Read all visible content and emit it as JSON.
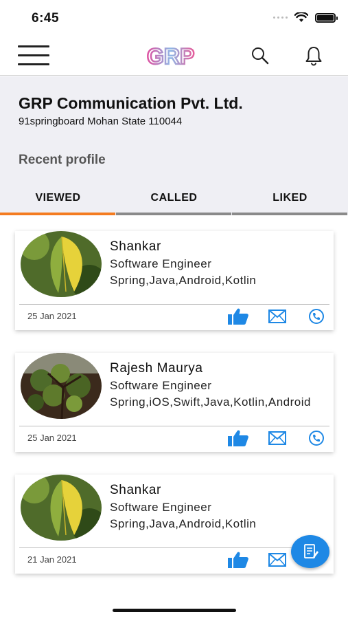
{
  "status_bar": {
    "time": "6:45"
  },
  "app_bar": {
    "logo_text": "GRP"
  },
  "company": {
    "name": "GRP Communication Pvt. Ltd.",
    "address": "91springboard Mohan State 110044"
  },
  "section_title": "Recent profile",
  "tabs": [
    {
      "label": "VIEWED",
      "active": true
    },
    {
      "label": "CALLED",
      "active": false
    },
    {
      "label": "LIKED",
      "active": false
    }
  ],
  "profiles": [
    {
      "name": "Shankar",
      "role": "Software Engineer",
      "skills": "Spring,Java,Android,Kotlin",
      "date": "25 Jan 2021",
      "avatar_icon": "leaf-photo"
    },
    {
      "name": "Rajesh Maurya",
      "role": "Software Engineer",
      "skills": "Spring,iOS,Swift,Java,Kotlin,Android",
      "date": "25 Jan 2021",
      "avatar_icon": "tree-photo"
    },
    {
      "name": "Shankar",
      "role": "Software Engineer",
      "skills": "Spring,Java,Android,Kotlin",
      "date": "21 Jan 2021",
      "avatar_icon": "leaf-photo"
    }
  ],
  "colors": {
    "accent_tab": "#f47c20",
    "inactive_tab": "#8a8a8a",
    "action_blue": "#1e88e5",
    "header_bg": "#efeff4"
  },
  "fab": {
    "icon": "notes-icon"
  }
}
